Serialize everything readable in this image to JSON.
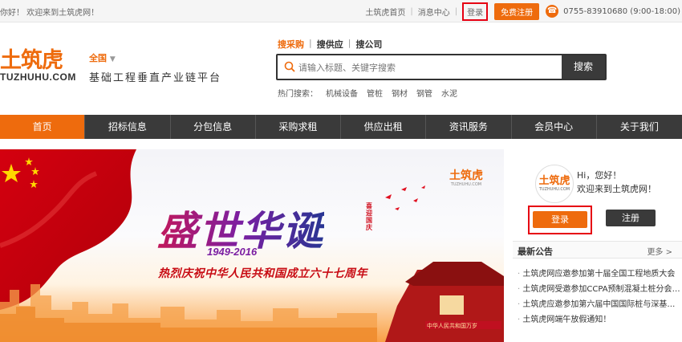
{
  "topbar": {
    "welcome": "你好！ 欢迎来到土筑虎网！",
    "home": "土筑虎首页",
    "messages": "消息中心",
    "login": "登录",
    "register": "免费注册",
    "phone": "0755-83910680 (9:00-18:00)"
  },
  "brand": {
    "logo_cn": "土筑虎",
    "logo_en": "TUZHUHU.COM",
    "region": "全国",
    "slogan": "基础工程垂直产业链平台"
  },
  "search": {
    "tabs": [
      "搜采购",
      "搜供应",
      "搜公司"
    ],
    "placeholder": "请输入标题、关键字搜索",
    "button": "搜索",
    "hot_label": "热门搜索：",
    "hot": [
      "机械设备",
      "管桩",
      "钢材",
      "钢管",
      "水泥"
    ]
  },
  "nav": [
    "首页",
    "招标信息",
    "分包信息",
    "采购求租",
    "供应出租",
    "资讯服务",
    "会员中心",
    "关于我们"
  ],
  "banner": {
    "title": "盛世华诞",
    "years": "1949-2016",
    "subtitle": "热烈庆祝中华人民共和国成立六十七周年",
    "side_text": "喜迎国庆",
    "logo_cn": "土筑虎",
    "logo_en": "TUZHUHU.COM",
    "gate_text": "中华人民共和国万岁"
  },
  "user_panel": {
    "avatar_cn": "土筑虎",
    "avatar_en": "TUZHUHU.COM",
    "greeting": "Hi，您好！",
    "welcome": "欢迎来到土筑虎网！",
    "login": "登录",
    "register": "注册"
  },
  "news": {
    "title": "最新公告",
    "more": "更多 >",
    "items": [
      "土筑虎网应邀参加第十届全国工程地质大会",
      "土筑虎网受邀参加CCPA预制混凝土桩分会2...",
      "土筑虎应邀参加第六届中国国际桩与深基础...",
      "土筑虎网端午放假通知！"
    ]
  }
}
